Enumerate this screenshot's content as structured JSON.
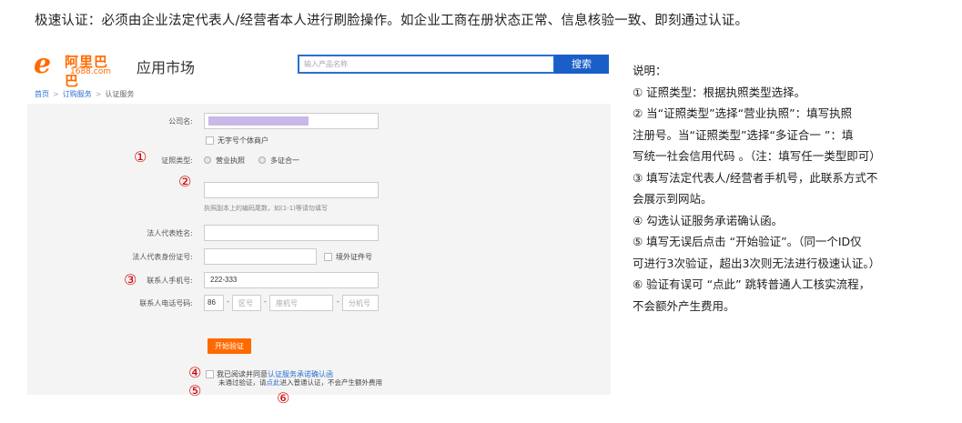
{
  "top_note": "极速认证：必须由企业法定代表人/经营者本人进行刷脸操作。如企业工商在册状态正常、信息核验一致、即刻通过认证。",
  "header": {
    "logo_main": "阿里巴巴",
    "logo_sub": "1688.com",
    "app_title": "应用市场",
    "search_placeholder": "输入产品名称",
    "search_button": "搜索"
  },
  "breadcrumb": [
    "首页",
    "订购服务",
    "认证服务"
  ],
  "form": {
    "company_name_label": "公司名:",
    "company_name_value": "",
    "no_name_checkbox": "无字号个体商户",
    "license_type_label": "证照类型:",
    "license_type_options": [
      "营业执照",
      "多证合一"
    ],
    "license_number_value": "",
    "license_hint": "执照副本上的编码尾数，如(1-1)等请勿填写",
    "legal_name_label": "法人代表姓名:",
    "legal_id_label": "法人代表身份证号:",
    "overseas_id_checkbox": "境外证件号",
    "contact_mobile_label": "联系人手机号:",
    "contact_mobile_value": "222-333",
    "contact_phone_label": "联系人电话号码:",
    "phone_country_code": "86",
    "phone_area_placeholder": "区号",
    "phone_number_placeholder": "座机号",
    "phone_ext_placeholder": "分机号",
    "agree_prefix": "我已阅读并同意",
    "agree_link": "认证服务承诺确认函",
    "start_button": "开始验证"
  },
  "bottom_note": {
    "prefix": "未通过验证，请",
    "link": "点此",
    "suffix": "进入普通认证，不会产生额外费用"
  },
  "markers": [
    "①",
    "②",
    "③",
    "④",
    "⑤",
    "⑥"
  ],
  "explanation": {
    "title": "说明：",
    "lines": [
      "① 证照类型：根据执照类型选择。",
      "② 当“证照类型”选择“营业执照”：填写执照",
      "注册号。当“证照类型”选择“多证合一 ”：填",
      "写统一社会信用代码 。（注：填写任一类型即可）",
      "③ 填写法定代表人/经营者手机号，此联系方式不",
      "会展示到网站。",
      "④ 勾选认证服务承诺确认函。",
      "⑤ 填写无误后点击 “开始验证”。（同一个ID仅",
      "可进行3次验证，超出3次则无法进行极速认证。）",
      "⑥ 验证有误可 “点此” 跳转普通人工核实流程，",
      "不会额外产生费用。"
    ]
  },
  "colors": {
    "brand_orange": "#ff6a00",
    "search_blue": "#1a5fc8",
    "marker_red": "#d30000",
    "link_blue": "#2a6fd0",
    "company_fill": "#c9b8e8"
  }
}
